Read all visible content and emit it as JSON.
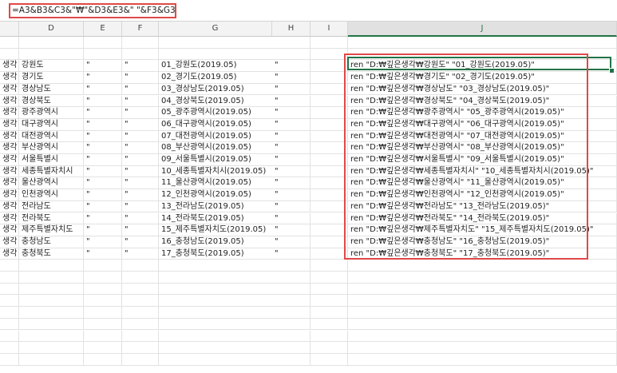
{
  "formula_bar": {
    "formula": "=A3&B3&C3&\"₩\"&D3&E3&\" \"&F3&G3&H3"
  },
  "columns": [
    "D",
    "E",
    "F",
    "G",
    "H",
    "I",
    "J"
  ],
  "selected_column": "J",
  "rows": [
    {
      "c": "생각",
      "d": "강원도",
      "e": "\"",
      "f": "\"",
      "g": "01_강원도(2019.05)",
      "h": "\"",
      "j": "ren \"D:₩깊은생각₩강원도\" \"01_강원도(2019.05)\""
    },
    {
      "c": "생각",
      "d": "경기도",
      "e": "\"",
      "f": "\"",
      "g": "02_경기도(2019.05)",
      "h": "\"",
      "j": "ren \"D:₩깊은생각₩경기도\" \"02_경기도(2019.05)\""
    },
    {
      "c": "생각",
      "d": "경상남도",
      "e": "\"",
      "f": "\"",
      "g": "03_경상남도(2019.05)",
      "h": "\"",
      "j": "ren \"D:₩깊은생각₩경상남도\" \"03_경상남도(2019.05)\""
    },
    {
      "c": "생각",
      "d": "경상북도",
      "e": "\"",
      "f": "\"",
      "g": "04_경상북도(2019.05)",
      "h": "\"",
      "j": "ren \"D:₩깊은생각₩경상북도\" \"04_경상북도(2019.05)\""
    },
    {
      "c": "생각",
      "d": "광주광역시",
      "e": "\"",
      "f": "\"",
      "g": "05_광주광역시(2019.05)",
      "h": "\"",
      "j": "ren \"D:₩깊은생각₩광주광역시\" \"05_광주광역시(2019.05)\""
    },
    {
      "c": "생각",
      "d": "대구광역시",
      "e": "\"",
      "f": "\"",
      "g": "06_대구광역시(2019.05)",
      "h": "\"",
      "j": "ren \"D:₩깊은생각₩대구광역시\" \"06_대구광역시(2019.05)\""
    },
    {
      "c": "생각",
      "d": "대전광역시",
      "e": "\"",
      "f": "\"",
      "g": "07_대전광역시(2019.05)",
      "h": "\"",
      "j": "ren \"D:₩깊은생각₩대전광역시\" \"07_대전광역시(2019.05)\""
    },
    {
      "c": "생각",
      "d": "부산광역시",
      "e": "\"",
      "f": "\"",
      "g": "08_부산광역시(2019.05)",
      "h": "\"",
      "j": "ren \"D:₩깊은생각₩부산광역시\" \"08_부산광역시(2019.05)\""
    },
    {
      "c": "생각",
      "d": "서울특별시",
      "e": "\"",
      "f": "\"",
      "g": "09_서울특별시(2019.05)",
      "h": "\"",
      "j": "ren \"D:₩깊은생각₩서울특별시\" \"09_서울특별시(2019.05)\""
    },
    {
      "c": "생각",
      "d": "세종특별자치시",
      "e": "\"",
      "f": "\"",
      "g": "10_세종특별자치시(2019.05)",
      "h": "\"",
      "j": "ren \"D:₩깊은생각₩세종특별자치시\" \"10_세종특별자치시(2019.05)\""
    },
    {
      "c": "생각",
      "d": "울산광역시",
      "e": "\"",
      "f": "\"",
      "g": "11_울산광역시(2019.05)",
      "h": "\"",
      "j": "ren \"D:₩깊은생각₩울산광역시\" \"11_울산광역시(2019.05)\""
    },
    {
      "c": "생각",
      "d": "인천광역시",
      "e": "\"",
      "f": "\"",
      "g": "12_인천광역시(2019.05)",
      "h": "\"",
      "j": "ren \"D:₩깊은생각₩인천광역시\" \"12_인천광역시(2019.05)\""
    },
    {
      "c": "생각",
      "d": "전라남도",
      "e": "\"",
      "f": "\"",
      "g": "13_전라남도(2019.05)",
      "h": "\"",
      "j": "ren \"D:₩깊은생각₩전라남도\" \"13_전라남도(2019.05)\""
    },
    {
      "c": "생각",
      "d": "전라북도",
      "e": "\"",
      "f": "\"",
      "g": "14_전라북도(2019.05)",
      "h": "\"",
      "j": "ren \"D:₩깊은생각₩전라북도\" \"14_전라북도(2019.05)\""
    },
    {
      "c": "생각",
      "d": "제주특별자치도",
      "e": "\"",
      "f": "\"",
      "g": "15_제주특별자치도(2019.05)",
      "h": "\"",
      "j": "ren \"D:₩깊은생각₩제주특별자치도\" \"15_제주특별자치도(2019.05)\""
    },
    {
      "c": "생각",
      "d": "충청남도",
      "e": "\"",
      "f": "\"",
      "g": "16_충청남도(2019.05)",
      "h": "\"",
      "j": "ren \"D:₩깊은생각₩충청남도\" \"16_충청남도(2019.05)\""
    },
    {
      "c": "생각",
      "d": "충청북도",
      "e": "\"",
      "f": "\"",
      "g": "17_충청북도(2019.05)",
      "h": "\"",
      "j": "ren \"D:₩깊은생각₩충청북도\" \"17_충청북도(2019.05)\""
    }
  ],
  "colors": {
    "accent": "#217346",
    "highlight": "#e04848"
  }
}
